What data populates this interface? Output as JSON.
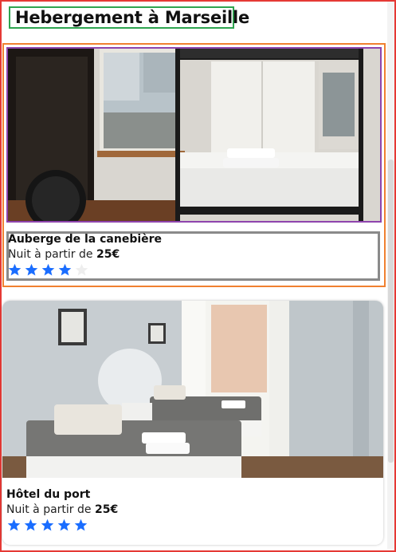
{
  "page": {
    "title": "Hebergement à Marseille"
  },
  "hotels": [
    {
      "name": "Auberge de la canebière",
      "price_prefix": "Nuit à partir de ",
      "price": "25€",
      "rating": 4,
      "max_rating": 5,
      "image_name": "dormitory-bunk-bed-photo"
    },
    {
      "name": "Hôtel du port",
      "price_prefix": "Nuit à partir de ",
      "price": "25€",
      "rating": 5,
      "max_rating": 5,
      "image_name": "twin-beds-room-photo"
    }
  ],
  "colors": {
    "star_filled": "#1a6dff",
    "star_empty": "#eeeeee",
    "title_outline": "#2ea44f",
    "card_outline": "#f08030",
    "image_outline": "#8e44ad",
    "info_outline": "#8a8a8a",
    "page_outline": "#e53935"
  },
  "icons": {
    "star": "star-icon"
  }
}
